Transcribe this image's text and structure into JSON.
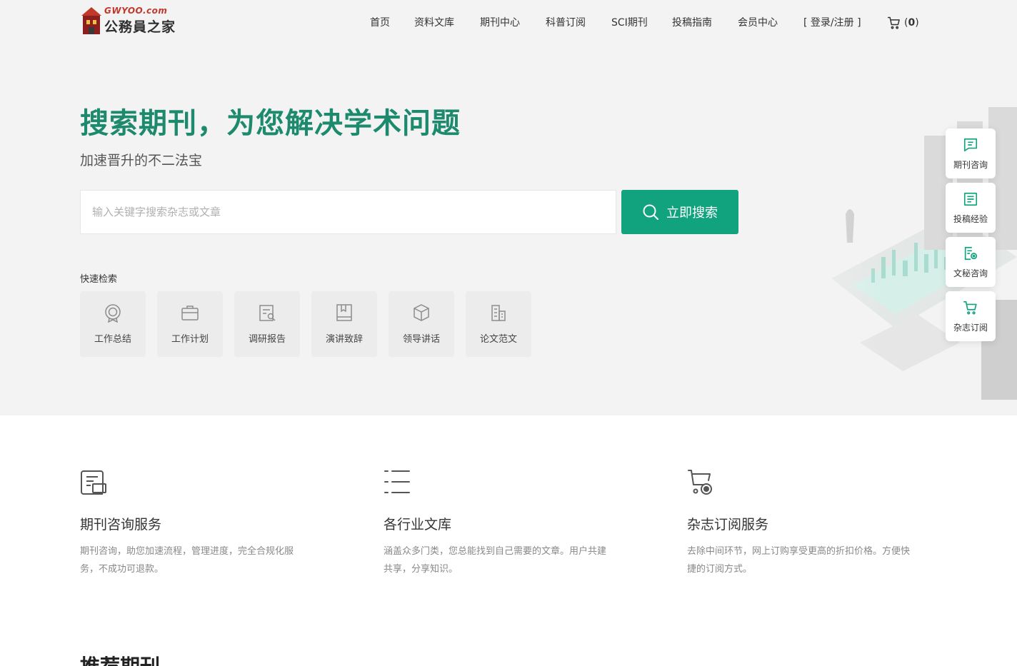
{
  "header": {
    "logo_domain": "GWYOO.com",
    "logo_name": "公務員之家",
    "nav": [
      {
        "label": "首页"
      },
      {
        "label": "资料文库"
      },
      {
        "label": "期刊中心"
      },
      {
        "label": "科普订阅"
      },
      {
        "label": "SCI期刊"
      },
      {
        "label": "投稿指南"
      },
      {
        "label": "会员中心"
      },
      {
        "label": "[ 登录/注册 ]"
      }
    ],
    "cart_open": "(",
    "cart_count": "0",
    "cart_close": ")"
  },
  "hero": {
    "headline": "搜索期刊，为您解决学术问题",
    "subline": "加速晋升的不二法宝",
    "search_placeholder": "输入关键字搜索杂志或文章",
    "search_value": "",
    "search_button": "立即搜索",
    "quick_label": "快速检索",
    "quick_items": [
      {
        "label": "工作总结",
        "icon": "badge-icon"
      },
      {
        "label": "工作计划",
        "icon": "briefcase-icon"
      },
      {
        "label": "调研报告",
        "icon": "report-icon"
      },
      {
        "label": "演讲致辞",
        "icon": "book-icon"
      },
      {
        "label": "领导讲话",
        "icon": "cube-icon"
      },
      {
        "label": "论文范文",
        "icon": "building-icon"
      }
    ]
  },
  "sidebar": [
    {
      "label": "期刊咨询",
      "icon": "chat-icon"
    },
    {
      "label": "投稿经验",
      "icon": "document-icon"
    },
    {
      "label": "文秘咨询",
      "icon": "file-settings-icon"
    },
    {
      "label": "杂志订阅",
      "icon": "cart-icon"
    }
  ],
  "features": [
    {
      "title": "期刊咨询服务",
      "desc": "期刊咨询，助您加速流程，管理进度，完全合规化服务，不成功可退款。",
      "icon": "consult-icon"
    },
    {
      "title": "各行业文库",
      "desc": "涵盖众多门类，您总能找到自己需要的文章。用户共建共享，分享知识。",
      "icon": "list-icon"
    },
    {
      "title": "杂志订阅服务",
      "desc": "去除中间环节，网上订购享受更高的折扣价格。方便快捷的订阅方式。",
      "icon": "cart-icon"
    }
  ],
  "sections": {
    "recommended_title": "推荐期刊"
  },
  "colors": {
    "brand": "#11a27e",
    "headline": "#1d8a6e",
    "hero_bg": "#f3f3f3"
  }
}
